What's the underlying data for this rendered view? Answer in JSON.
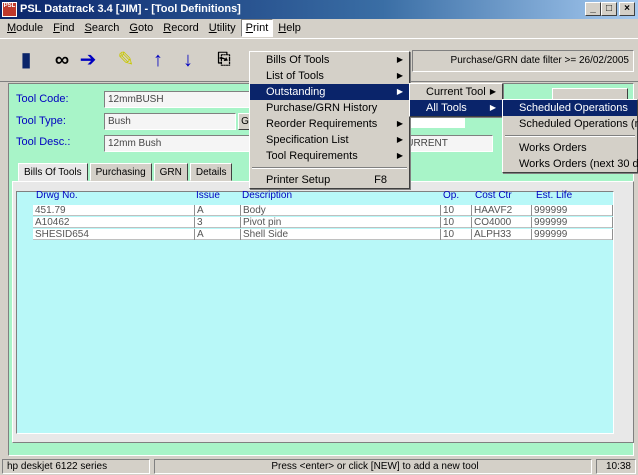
{
  "window": {
    "title": "PSL Datatrack 3.4 [JIM] - [Tool Definitions]",
    "icon_text": "PSL",
    "minimize_glyph": "_",
    "maximize_glyph": "□",
    "close_glyph": "×"
  },
  "menubar": {
    "items": [
      {
        "label": "Module",
        "u": "M",
        "rest": "odule"
      },
      {
        "label": "Find",
        "u": "F",
        "rest": "ind"
      },
      {
        "label": "Search",
        "u": "S",
        "rest": "earch"
      },
      {
        "label": "Goto",
        "u": "G",
        "rest": "oto"
      },
      {
        "label": "Record",
        "u": "R",
        "rest": "ecord"
      },
      {
        "label": "Utility",
        "u": "U",
        "rest": "tility"
      },
      {
        "label": "Print",
        "u": "P",
        "rest": "rint"
      },
      {
        "label": "Help",
        "u": "H",
        "rest": "elp"
      }
    ]
  },
  "toolbar": {
    "icons": [
      "exit-door-icon",
      "binoculars-icon",
      "arrow-right-icon",
      "pen-icon",
      "arrow-up-icon",
      "arrow-down-icon",
      "copy-icon"
    ],
    "filter_text": "Purchase/GRN date filter >= 26/02/2005"
  },
  "form": {
    "tool_code_label": "Tool Code:",
    "tool_code_value": "12mmBUSH",
    "tool_type_label": "Tool Type:",
    "tool_type_value": "Bush",
    "tool_desc_label": "Tool Desc.:",
    "tool_desc_value": "12mm Bush",
    "status_value": "CURRENT",
    "type_button_label": "G"
  },
  "tabs": [
    {
      "label": "Bills Of Tools",
      "selected": true
    },
    {
      "label": "Purchasing",
      "selected": false
    },
    {
      "label": "GRN",
      "selected": false
    },
    {
      "label": "Details",
      "selected": false
    }
  ],
  "grid": {
    "headers": [
      "Drwg No.",
      "Issue",
      "Description",
      "Op.",
      "Cost Ctr",
      "Est. Life"
    ],
    "rows": [
      [
        "451.79",
        "A",
        "Body",
        "10",
        "HAAVF2",
        "999999"
      ],
      [
        "A10462",
        "3",
        "Pivot pin",
        "10",
        "CO4000",
        "999999"
      ],
      [
        "SHESID654",
        "A",
        "Shell Side",
        "10",
        "ALPH33",
        "999999"
      ]
    ]
  },
  "print_menu": {
    "items": [
      {
        "label": "Bills Of Tools",
        "submenu": true
      },
      {
        "label": "List of Tools",
        "submenu": true
      },
      {
        "label": "Outstanding",
        "submenu": true,
        "highlighted": true
      },
      {
        "label": "Purchase/GRN History",
        "submenu": false
      },
      {
        "label": "Reorder Requirements",
        "submenu": true
      },
      {
        "label": "Specification List",
        "submenu": true
      },
      {
        "label": "Tool Requirements",
        "submenu": true
      },
      {
        "label": "Printer Setup",
        "accelerator": "F8"
      }
    ]
  },
  "outstanding_menu": {
    "items": [
      {
        "label": "Current Tool",
        "highlighted": false
      },
      {
        "label": "All Tools",
        "highlighted": true
      }
    ]
  },
  "alltools_menu": {
    "items": [
      {
        "label": "Scheduled Operations",
        "highlighted": true
      },
      {
        "label": "Scheduled Operations (n",
        "highlighted": false
      },
      {
        "label": "Works Orders",
        "highlighted": false
      },
      {
        "label": "Works Orders (next 30 d",
        "highlighted": false
      }
    ]
  },
  "statusbar": {
    "printer": "hp deskjet 6122 series",
    "message": "Press <enter> or click [NEW] to add a new tool",
    "time": "10:38"
  }
}
